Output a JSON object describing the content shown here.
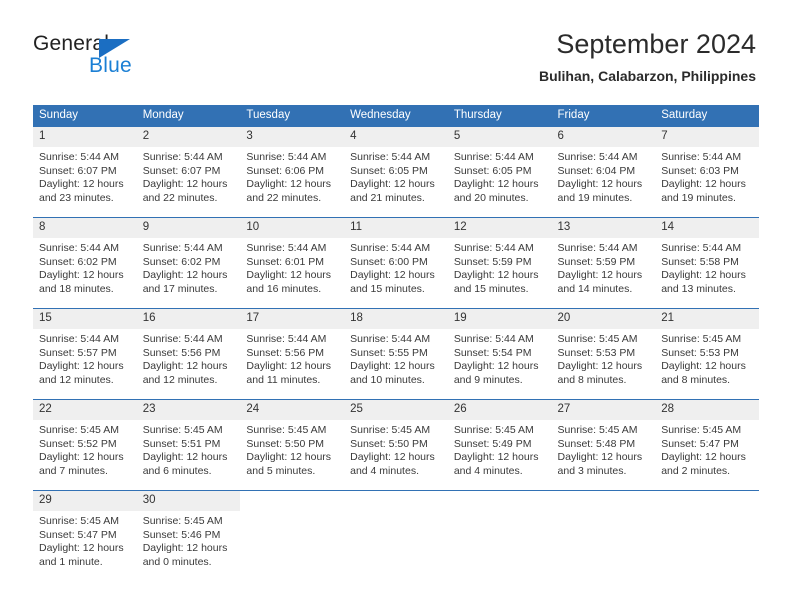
{
  "brand": {
    "name_top": "General",
    "name_bottom": "Blue",
    "accent_color": "#1b7fd4"
  },
  "header": {
    "title": "September 2024",
    "subtitle": "Bulihan, Calabarzon, Philippines"
  },
  "theme": {
    "header_bg": "#3271b4",
    "daynum_bg": "#efefef",
    "text": "#3a3a3a"
  },
  "weekday_headers": [
    "Sunday",
    "Monday",
    "Tuesday",
    "Wednesday",
    "Thursday",
    "Friday",
    "Saturday"
  ],
  "weeks": [
    [
      {
        "day": "1",
        "sunrise": "Sunrise: 5:44 AM",
        "sunset": "Sunset: 6:07 PM",
        "daylight1": "Daylight: 12 hours",
        "daylight2": "and 23 minutes."
      },
      {
        "day": "2",
        "sunrise": "Sunrise: 5:44 AM",
        "sunset": "Sunset: 6:07 PM",
        "daylight1": "Daylight: 12 hours",
        "daylight2": "and 22 minutes."
      },
      {
        "day": "3",
        "sunrise": "Sunrise: 5:44 AM",
        "sunset": "Sunset: 6:06 PM",
        "daylight1": "Daylight: 12 hours",
        "daylight2": "and 22 minutes."
      },
      {
        "day": "4",
        "sunrise": "Sunrise: 5:44 AM",
        "sunset": "Sunset: 6:05 PM",
        "daylight1": "Daylight: 12 hours",
        "daylight2": "and 21 minutes."
      },
      {
        "day": "5",
        "sunrise": "Sunrise: 5:44 AM",
        "sunset": "Sunset: 6:05 PM",
        "daylight1": "Daylight: 12 hours",
        "daylight2": "and 20 minutes."
      },
      {
        "day": "6",
        "sunrise": "Sunrise: 5:44 AM",
        "sunset": "Sunset: 6:04 PM",
        "daylight1": "Daylight: 12 hours",
        "daylight2": "and 19 minutes."
      },
      {
        "day": "7",
        "sunrise": "Sunrise: 5:44 AM",
        "sunset": "Sunset: 6:03 PM",
        "daylight1": "Daylight: 12 hours",
        "daylight2": "and 19 minutes."
      }
    ],
    [
      {
        "day": "8",
        "sunrise": "Sunrise: 5:44 AM",
        "sunset": "Sunset: 6:02 PM",
        "daylight1": "Daylight: 12 hours",
        "daylight2": "and 18 minutes."
      },
      {
        "day": "9",
        "sunrise": "Sunrise: 5:44 AM",
        "sunset": "Sunset: 6:02 PM",
        "daylight1": "Daylight: 12 hours",
        "daylight2": "and 17 minutes."
      },
      {
        "day": "10",
        "sunrise": "Sunrise: 5:44 AM",
        "sunset": "Sunset: 6:01 PM",
        "daylight1": "Daylight: 12 hours",
        "daylight2": "and 16 minutes."
      },
      {
        "day": "11",
        "sunrise": "Sunrise: 5:44 AM",
        "sunset": "Sunset: 6:00 PM",
        "daylight1": "Daylight: 12 hours",
        "daylight2": "and 15 minutes."
      },
      {
        "day": "12",
        "sunrise": "Sunrise: 5:44 AM",
        "sunset": "Sunset: 5:59 PM",
        "daylight1": "Daylight: 12 hours",
        "daylight2": "and 15 minutes."
      },
      {
        "day": "13",
        "sunrise": "Sunrise: 5:44 AM",
        "sunset": "Sunset: 5:59 PM",
        "daylight1": "Daylight: 12 hours",
        "daylight2": "and 14 minutes."
      },
      {
        "day": "14",
        "sunrise": "Sunrise: 5:44 AM",
        "sunset": "Sunset: 5:58 PM",
        "daylight1": "Daylight: 12 hours",
        "daylight2": "and 13 minutes."
      }
    ],
    [
      {
        "day": "15",
        "sunrise": "Sunrise: 5:44 AM",
        "sunset": "Sunset: 5:57 PM",
        "daylight1": "Daylight: 12 hours",
        "daylight2": "and 12 minutes."
      },
      {
        "day": "16",
        "sunrise": "Sunrise: 5:44 AM",
        "sunset": "Sunset: 5:56 PM",
        "daylight1": "Daylight: 12 hours",
        "daylight2": "and 12 minutes."
      },
      {
        "day": "17",
        "sunrise": "Sunrise: 5:44 AM",
        "sunset": "Sunset: 5:56 PM",
        "daylight1": "Daylight: 12 hours",
        "daylight2": "and 11 minutes."
      },
      {
        "day": "18",
        "sunrise": "Sunrise: 5:44 AM",
        "sunset": "Sunset: 5:55 PM",
        "daylight1": "Daylight: 12 hours",
        "daylight2": "and 10 minutes."
      },
      {
        "day": "19",
        "sunrise": "Sunrise: 5:44 AM",
        "sunset": "Sunset: 5:54 PM",
        "daylight1": "Daylight: 12 hours",
        "daylight2": "and 9 minutes."
      },
      {
        "day": "20",
        "sunrise": "Sunrise: 5:45 AM",
        "sunset": "Sunset: 5:53 PM",
        "daylight1": "Daylight: 12 hours",
        "daylight2": "and 8 minutes."
      },
      {
        "day": "21",
        "sunrise": "Sunrise: 5:45 AM",
        "sunset": "Sunset: 5:53 PM",
        "daylight1": "Daylight: 12 hours",
        "daylight2": "and 8 minutes."
      }
    ],
    [
      {
        "day": "22",
        "sunrise": "Sunrise: 5:45 AM",
        "sunset": "Sunset: 5:52 PM",
        "daylight1": "Daylight: 12 hours",
        "daylight2": "and 7 minutes."
      },
      {
        "day": "23",
        "sunrise": "Sunrise: 5:45 AM",
        "sunset": "Sunset: 5:51 PM",
        "daylight1": "Daylight: 12 hours",
        "daylight2": "and 6 minutes."
      },
      {
        "day": "24",
        "sunrise": "Sunrise: 5:45 AM",
        "sunset": "Sunset: 5:50 PM",
        "daylight1": "Daylight: 12 hours",
        "daylight2": "and 5 minutes."
      },
      {
        "day": "25",
        "sunrise": "Sunrise: 5:45 AM",
        "sunset": "Sunset: 5:50 PM",
        "daylight1": "Daylight: 12 hours",
        "daylight2": "and 4 minutes."
      },
      {
        "day": "26",
        "sunrise": "Sunrise: 5:45 AM",
        "sunset": "Sunset: 5:49 PM",
        "daylight1": "Daylight: 12 hours",
        "daylight2": "and 4 minutes."
      },
      {
        "day": "27",
        "sunrise": "Sunrise: 5:45 AM",
        "sunset": "Sunset: 5:48 PM",
        "daylight1": "Daylight: 12 hours",
        "daylight2": "and 3 minutes."
      },
      {
        "day": "28",
        "sunrise": "Sunrise: 5:45 AM",
        "sunset": "Sunset: 5:47 PM",
        "daylight1": "Daylight: 12 hours",
        "daylight2": "and 2 minutes."
      }
    ],
    [
      {
        "day": "29",
        "sunrise": "Sunrise: 5:45 AM",
        "sunset": "Sunset: 5:47 PM",
        "daylight1": "Daylight: 12 hours",
        "daylight2": "and 1 minute."
      },
      {
        "day": "30",
        "sunrise": "Sunrise: 5:45 AM",
        "sunset": "Sunset: 5:46 PM",
        "daylight1": "Daylight: 12 hours",
        "daylight2": "and 0 minutes."
      },
      {
        "day": "",
        "sunrise": "",
        "sunset": "",
        "daylight1": "",
        "daylight2": ""
      },
      {
        "day": "",
        "sunrise": "",
        "sunset": "",
        "daylight1": "",
        "daylight2": ""
      },
      {
        "day": "",
        "sunrise": "",
        "sunset": "",
        "daylight1": "",
        "daylight2": ""
      },
      {
        "day": "",
        "sunrise": "",
        "sunset": "",
        "daylight1": "",
        "daylight2": ""
      },
      {
        "day": "",
        "sunrise": "",
        "sunset": "",
        "daylight1": "",
        "daylight2": ""
      }
    ]
  ]
}
